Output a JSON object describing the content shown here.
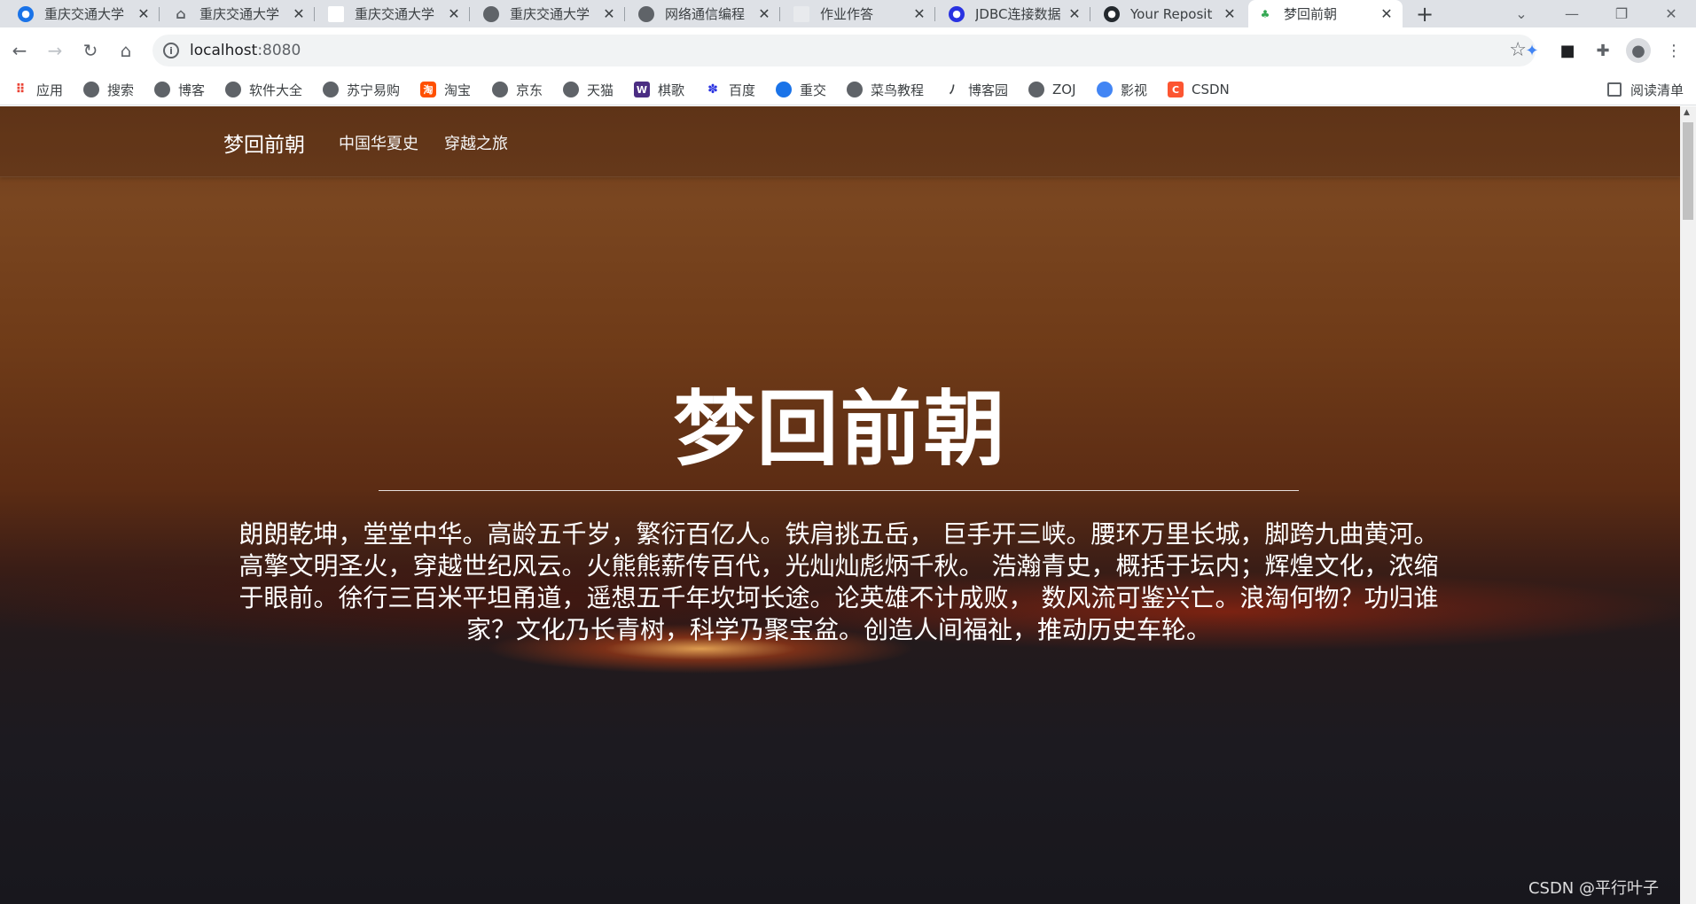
{
  "tabs": [
    {
      "title": "重庆交通大学",
      "icon": "circle-icon",
      "color": "#1a73e8"
    },
    {
      "title": "重庆交通大学",
      "icon": "home-icon",
      "color": "#5f6368"
    },
    {
      "title": "重庆交通大学",
      "icon": "blank-page-icon",
      "color": "#ffffff"
    },
    {
      "title": "重庆交通大学",
      "icon": "globe-icon",
      "color": "#5f6368"
    },
    {
      "title": "网络通信编程",
      "icon": "globe-icon",
      "color": "#5f6368"
    },
    {
      "title": "作业作答",
      "icon": "blank-page-icon",
      "color": "#e8eaed"
    },
    {
      "title": "JDBC连接数据",
      "icon": "baidu-icon",
      "color": "#2932e1"
    },
    {
      "title": "Your Reposit",
      "icon": "github-icon",
      "color": "#24292e"
    },
    {
      "title": "梦回前朝",
      "icon": "leaf-icon",
      "color": "#34a853",
      "active": true
    }
  ],
  "address": {
    "host": "localhost",
    "port": ":8080"
  },
  "bookmarks": [
    {
      "label": "应用",
      "icon": "apps-grid-icon",
      "color": "#ea4335"
    },
    {
      "label": "搜索",
      "icon": "globe-icon",
      "color": "#5f6368"
    },
    {
      "label": "博客",
      "icon": "globe-icon",
      "color": "#5f6368"
    },
    {
      "label": "软件大全",
      "icon": "globe-icon",
      "color": "#5f6368"
    },
    {
      "label": "苏宁易购",
      "icon": "globe-icon",
      "color": "#5f6368"
    },
    {
      "label": "淘宝",
      "icon": "taobao-icon",
      "color": "#ff5000"
    },
    {
      "label": "京东",
      "icon": "globe-icon",
      "color": "#5f6368"
    },
    {
      "label": "天猫",
      "icon": "globe-icon",
      "color": "#5f6368"
    },
    {
      "label": "棋歌",
      "icon": "w-letter-icon",
      "color": "#4b2d83"
    },
    {
      "label": "百度",
      "icon": "baidu-icon",
      "color": "#2932e1"
    },
    {
      "label": "重交",
      "icon": "circle-icon",
      "color": "#1a73e8"
    },
    {
      "label": "菜鸟教程",
      "icon": "globe-icon",
      "color": "#5f6368"
    },
    {
      "label": "博客园",
      "icon": "cnblogs-icon",
      "color": "#5f6368"
    },
    {
      "label": "ZOJ",
      "icon": "globe-icon",
      "color": "#5f6368"
    },
    {
      "label": "影视",
      "icon": "film-icon",
      "color": "#4285f4"
    },
    {
      "label": "CSDN",
      "icon": "csdn-icon",
      "color": "#fc5531"
    }
  ],
  "reading_list": "阅读清单",
  "site": {
    "brand": "梦回前朝",
    "nav": [
      "中国华夏史",
      "穿越之旅"
    ],
    "hero_title": "梦回前朝",
    "hero_text": "朗朗乾坤，堂堂中华。高龄五千岁，繁衍百亿人。铁肩挑五岳， 巨手开三峡。腰环万里长城，脚跨九曲黄河。高擎文明圣火，穿越世纪风云。火熊熊薪传百代，光灿灿彪炳千秋。 浩瀚青史，概括于坛内；辉煌文化，浓缩于眼前。徐行三百米平坦甬道，遥想五千年坎坷长途。论英雄不计成败， 数风流可鉴兴亡。浪淘何物？功归谁家？文化乃长青树，科学乃聚宝盆。创造人间福祉，推动历史车轮。"
  },
  "watermark": "CSDN @平行叶子"
}
